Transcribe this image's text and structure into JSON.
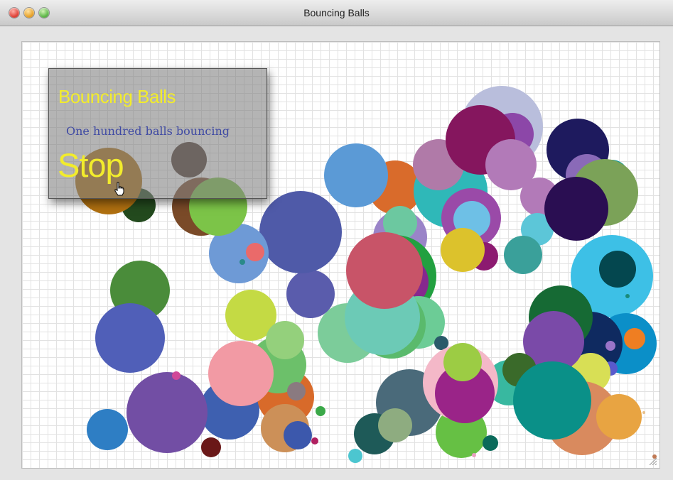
{
  "window": {
    "title": "Bouncing Balls"
  },
  "overlay": {
    "heading": "Bouncing Balls",
    "subtitle": "One hundred balls bouncing",
    "stop_label": "Stop"
  },
  "colors": {
    "overlay_text": "#f2ec2c",
    "subtitle_text": "#3f4aa3"
  }
}
